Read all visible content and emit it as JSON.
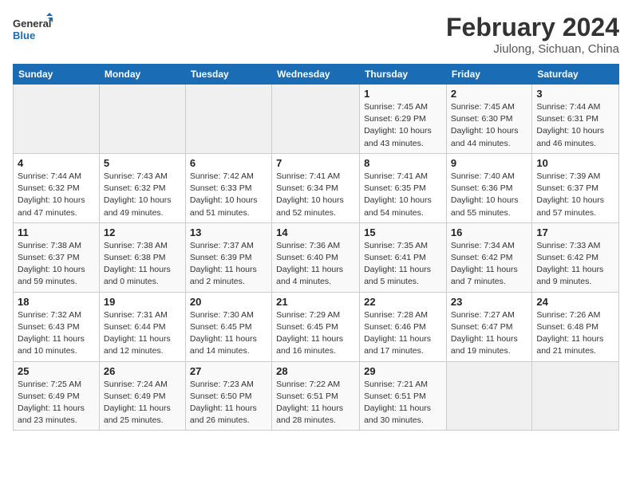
{
  "header": {
    "logo_text_general": "General",
    "logo_text_blue": "Blue",
    "month_year": "February 2024",
    "location": "Jiulong, Sichuan, China"
  },
  "days_of_week": [
    "Sunday",
    "Monday",
    "Tuesday",
    "Wednesday",
    "Thursday",
    "Friday",
    "Saturday"
  ],
  "weeks": [
    [
      {
        "day": "",
        "info": ""
      },
      {
        "day": "",
        "info": ""
      },
      {
        "day": "",
        "info": ""
      },
      {
        "day": "",
        "info": ""
      },
      {
        "day": "1",
        "info": "Sunrise: 7:45 AM\nSunset: 6:29 PM\nDaylight: 10 hours and 43 minutes."
      },
      {
        "day": "2",
        "info": "Sunrise: 7:45 AM\nSunset: 6:30 PM\nDaylight: 10 hours and 44 minutes."
      },
      {
        "day": "3",
        "info": "Sunrise: 7:44 AM\nSunset: 6:31 PM\nDaylight: 10 hours and 46 minutes."
      }
    ],
    [
      {
        "day": "4",
        "info": "Sunrise: 7:44 AM\nSunset: 6:32 PM\nDaylight: 10 hours and 47 minutes."
      },
      {
        "day": "5",
        "info": "Sunrise: 7:43 AM\nSunset: 6:32 PM\nDaylight: 10 hours and 49 minutes."
      },
      {
        "day": "6",
        "info": "Sunrise: 7:42 AM\nSunset: 6:33 PM\nDaylight: 10 hours and 51 minutes."
      },
      {
        "day": "7",
        "info": "Sunrise: 7:41 AM\nSunset: 6:34 PM\nDaylight: 10 hours and 52 minutes."
      },
      {
        "day": "8",
        "info": "Sunrise: 7:41 AM\nSunset: 6:35 PM\nDaylight: 10 hours and 54 minutes."
      },
      {
        "day": "9",
        "info": "Sunrise: 7:40 AM\nSunset: 6:36 PM\nDaylight: 10 hours and 55 minutes."
      },
      {
        "day": "10",
        "info": "Sunrise: 7:39 AM\nSunset: 6:37 PM\nDaylight: 10 hours and 57 minutes."
      }
    ],
    [
      {
        "day": "11",
        "info": "Sunrise: 7:38 AM\nSunset: 6:37 PM\nDaylight: 10 hours and 59 minutes."
      },
      {
        "day": "12",
        "info": "Sunrise: 7:38 AM\nSunset: 6:38 PM\nDaylight: 11 hours and 0 minutes."
      },
      {
        "day": "13",
        "info": "Sunrise: 7:37 AM\nSunset: 6:39 PM\nDaylight: 11 hours and 2 minutes."
      },
      {
        "day": "14",
        "info": "Sunrise: 7:36 AM\nSunset: 6:40 PM\nDaylight: 11 hours and 4 minutes."
      },
      {
        "day": "15",
        "info": "Sunrise: 7:35 AM\nSunset: 6:41 PM\nDaylight: 11 hours and 5 minutes."
      },
      {
        "day": "16",
        "info": "Sunrise: 7:34 AM\nSunset: 6:42 PM\nDaylight: 11 hours and 7 minutes."
      },
      {
        "day": "17",
        "info": "Sunrise: 7:33 AM\nSunset: 6:42 PM\nDaylight: 11 hours and 9 minutes."
      }
    ],
    [
      {
        "day": "18",
        "info": "Sunrise: 7:32 AM\nSunset: 6:43 PM\nDaylight: 11 hours and 10 minutes."
      },
      {
        "day": "19",
        "info": "Sunrise: 7:31 AM\nSunset: 6:44 PM\nDaylight: 11 hours and 12 minutes."
      },
      {
        "day": "20",
        "info": "Sunrise: 7:30 AM\nSunset: 6:45 PM\nDaylight: 11 hours and 14 minutes."
      },
      {
        "day": "21",
        "info": "Sunrise: 7:29 AM\nSunset: 6:45 PM\nDaylight: 11 hours and 16 minutes."
      },
      {
        "day": "22",
        "info": "Sunrise: 7:28 AM\nSunset: 6:46 PM\nDaylight: 11 hours and 17 minutes."
      },
      {
        "day": "23",
        "info": "Sunrise: 7:27 AM\nSunset: 6:47 PM\nDaylight: 11 hours and 19 minutes."
      },
      {
        "day": "24",
        "info": "Sunrise: 7:26 AM\nSunset: 6:48 PM\nDaylight: 11 hours and 21 minutes."
      }
    ],
    [
      {
        "day": "25",
        "info": "Sunrise: 7:25 AM\nSunset: 6:49 PM\nDaylight: 11 hours and 23 minutes."
      },
      {
        "day": "26",
        "info": "Sunrise: 7:24 AM\nSunset: 6:49 PM\nDaylight: 11 hours and 25 minutes."
      },
      {
        "day": "27",
        "info": "Sunrise: 7:23 AM\nSunset: 6:50 PM\nDaylight: 11 hours and 26 minutes."
      },
      {
        "day": "28",
        "info": "Sunrise: 7:22 AM\nSunset: 6:51 PM\nDaylight: 11 hours and 28 minutes."
      },
      {
        "day": "29",
        "info": "Sunrise: 7:21 AM\nSunset: 6:51 PM\nDaylight: 11 hours and 30 minutes."
      },
      {
        "day": "",
        "info": ""
      },
      {
        "day": "",
        "info": ""
      }
    ]
  ]
}
